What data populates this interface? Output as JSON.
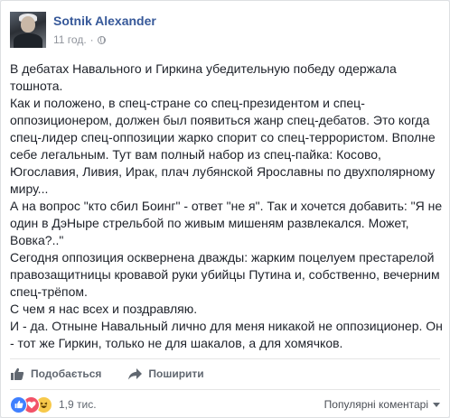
{
  "post": {
    "author": "Sotnik Alexander",
    "time": "11 год.",
    "dot": "·",
    "paragraphs": [
      "В дебатах Навального и Гиркина убедительную победу одержала тошнота.",
      "Как и положено, в спец-стране со спец-президентом и спец-оппозиционером, должен был появиться жанр спец-дебатов. Это когда спец-лидер спец-оппозиции жарко спорит со спец-террористом. Вполне себе легальным. Тут вам полный набор из спец-пайка: Косово, Югославия, Ливия, Ирак, плач лубянской Ярославны по двухполярному миру...",
      "А на вопрос \"кто сбил Боинг\" - ответ \"не я\". Так и хочется добавить: \"Я не один в ДэНыре стрельбой по живым мишеням развлекался. Может, Вовка?..\"",
      "Сегодня оппозиция осквернена дважды: жарким поцелуем престарелой правозащитницы кровавой руки убийцы Путина и, собственно, вечерним спец-трёпом.",
      "С чем я нас всех и поздравляю.",
      "И - да. Отныне Навальный лично для меня никакой не оппозиционер. Он - тот же Гиркин, только не для шакалов, а для хомячков."
    ]
  },
  "actions": {
    "like": "Подобається",
    "share": "Поширити"
  },
  "reactions": {
    "count": "1,9 тис."
  },
  "comments": {
    "sort_label": "Популярні коментарі"
  },
  "colors": {
    "link": "#365899",
    "like": "#4080ff",
    "love": "#f25268",
    "haha": "#f7c94b"
  },
  "icons": [
    "avatar",
    "globe-icon",
    "like-icon",
    "share-icon",
    "like-reaction-icon",
    "love-reaction-icon",
    "haha-reaction-icon",
    "caret-down-icon"
  ]
}
